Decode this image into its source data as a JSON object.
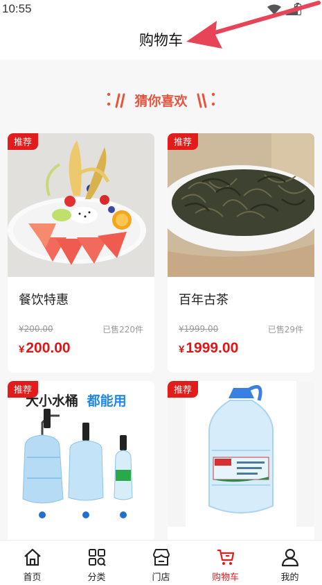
{
  "status_bar": {
    "time": "10:55"
  },
  "header": {
    "title": "购物车"
  },
  "recommend": {
    "title": "猜你喜欢"
  },
  "products": [
    {
      "badge": "推荐",
      "name": "餐饮特惠",
      "original_price": "¥200.00",
      "sold": "已售220件",
      "currency": "¥",
      "price": "200.00",
      "image": "fruit-platter"
    },
    {
      "badge": "推荐",
      "name": "百年古茶",
      "original_price": "¥1999.00",
      "sold": "已售29件",
      "currency": "¥",
      "price": "1999.00",
      "image": "tea-leaves"
    },
    {
      "badge": "推荐",
      "image_caption": "大小水桶",
      "image_caption_highlight": "都能用",
      "image": "water-pumps"
    },
    {
      "badge": "推荐",
      "image": "water-bottle"
    }
  ],
  "bottom_nav": [
    {
      "label": "首页",
      "icon": "home-icon",
      "active": false
    },
    {
      "label": "分类",
      "icon": "category-icon",
      "active": false
    },
    {
      "label": "门店",
      "icon": "store-icon",
      "active": false
    },
    {
      "label": "购物车",
      "icon": "cart-icon",
      "active": true
    },
    {
      "label": "我的",
      "icon": "user-icon",
      "active": false
    }
  ],
  "colors": {
    "accent": "#e21b1b",
    "recommend": "#e8533c",
    "price": "#e01515",
    "arrow": "#e84458"
  }
}
